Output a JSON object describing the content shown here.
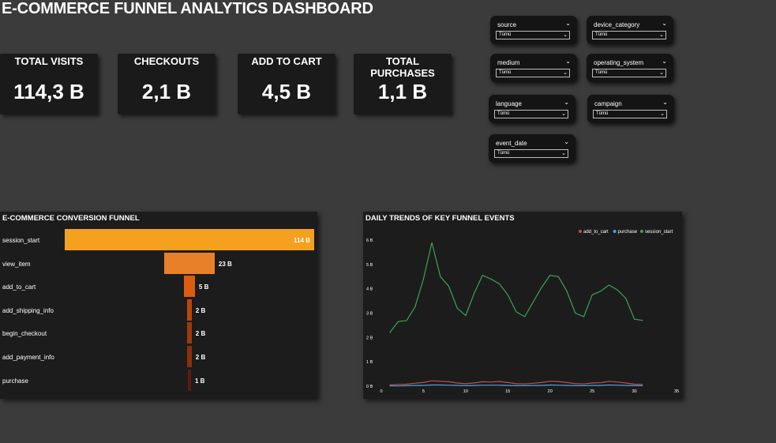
{
  "dashboard": {
    "title": "E-COMMERCE FUNNEL ANALYTICS DASHBOARD"
  },
  "kpis": [
    {
      "label": "TOTAL VISITS",
      "value": "114,3 B"
    },
    {
      "label": "CHECKOUTS",
      "value": "2,1 B"
    },
    {
      "label": "ADD TO CART",
      "value": "4,5 B"
    },
    {
      "label": "TOTAL PURCHASES",
      "value": "1,1 B"
    }
  ],
  "filters": [
    {
      "name": "source",
      "value": "Tümü"
    },
    {
      "name": "device_category",
      "value": "Tümü"
    },
    {
      "name": "medium",
      "value": "Tümü"
    },
    {
      "name": "operating_system",
      "value": "Tümü"
    },
    {
      "name": "language",
      "value": "Tümü"
    },
    {
      "name": "campaign",
      "value": "Tümü"
    },
    {
      "name": "event_date",
      "value": "Tümü"
    }
  ],
  "funnel": {
    "title": "E-COMMERCE CONVERSION FUNNEL",
    "max": 114,
    "steps": [
      {
        "label": "session_start",
        "value": 114,
        "value_label": "114 B",
        "color": "#f5a01e"
      },
      {
        "label": "view_item",
        "value": 23,
        "value_label": "23 B",
        "color": "#e8802a"
      },
      {
        "label": "add_to_cart",
        "value": 5,
        "value_label": "5 B",
        "color": "#dd5c10"
      },
      {
        "label": "add_shipping_info",
        "value": 2,
        "value_label": "2 B",
        "color": "#b8460c"
      },
      {
        "label": "begin_checkout",
        "value": 2,
        "value_label": "2 B",
        "color": "#9c3a0c"
      },
      {
        "label": "add_payment_info",
        "value": 2,
        "value_label": "2 B",
        "color": "#8a300c"
      },
      {
        "label": "purchase",
        "value": 1,
        "value_label": "1 B",
        "color": "#5c1c0c"
      }
    ]
  },
  "chart_data": {
    "type": "line",
    "title": "DAILY TRENDS OF KEY FUNNEL EVENTS",
    "xlim": [
      0,
      35
    ],
    "ylim": [
      0,
      6
    ],
    "x_ticks": [
      0,
      5,
      10,
      15,
      20,
      25,
      30,
      35
    ],
    "y_ticks": [
      {
        "value": 0,
        "label": "0 B"
      },
      {
        "value": 1,
        "label": "1 B"
      },
      {
        "value": 2,
        "label": "2 B"
      },
      {
        "value": 3,
        "label": "3 B"
      },
      {
        "value": 4,
        "label": "4 B"
      },
      {
        "value": 5,
        "label": "5 B"
      },
      {
        "value": 6,
        "label": "6 B"
      }
    ],
    "legend_position": "top-right",
    "x": [
      1,
      2,
      3,
      4,
      5,
      6,
      7,
      8,
      9,
      10,
      11,
      12,
      13,
      14,
      15,
      16,
      17,
      18,
      19,
      20,
      21,
      22,
      23,
      24,
      25,
      26,
      27,
      28,
      29,
      30,
      31
    ],
    "series": [
      {
        "name": "add_to_cart",
        "color": "#c0504d",
        "values": [
          0.05,
          0.07,
          0.08,
          0.12,
          0.15,
          0.22,
          0.2,
          0.18,
          0.13,
          0.1,
          0.13,
          0.18,
          0.17,
          0.19,
          0.15,
          0.1,
          0.09,
          0.12,
          0.15,
          0.2,
          0.19,
          0.15,
          0.1,
          0.09,
          0.13,
          0.14,
          0.2,
          0.17,
          0.13,
          0.08,
          0.07
        ]
      },
      {
        "name": "purchase",
        "color": "#4f9fdc",
        "values": [
          0.01,
          0.01,
          0.02,
          0.03,
          0.03,
          0.05,
          0.05,
          0.04,
          0.03,
          0.02,
          0.03,
          0.04,
          0.04,
          0.04,
          0.03,
          0.02,
          0.02,
          0.03,
          0.03,
          0.05,
          0.04,
          0.03,
          0.02,
          0.02,
          0.03,
          0.03,
          0.05,
          0.04,
          0.03,
          0.02,
          0.02
        ]
      },
      {
        "name": "session_start",
        "color": "#3aa454",
        "values": [
          2.2,
          2.65,
          2.7,
          3.25,
          4.4,
          5.9,
          4.5,
          4.1,
          3.2,
          2.9,
          3.8,
          4.55,
          4.4,
          4.2,
          3.75,
          3.05,
          2.85,
          3.45,
          4.05,
          4.55,
          4.5,
          3.9,
          3.0,
          2.85,
          3.75,
          3.9,
          4.15,
          3.95,
          3.6,
          2.75,
          2.7
        ]
      }
    ]
  }
}
